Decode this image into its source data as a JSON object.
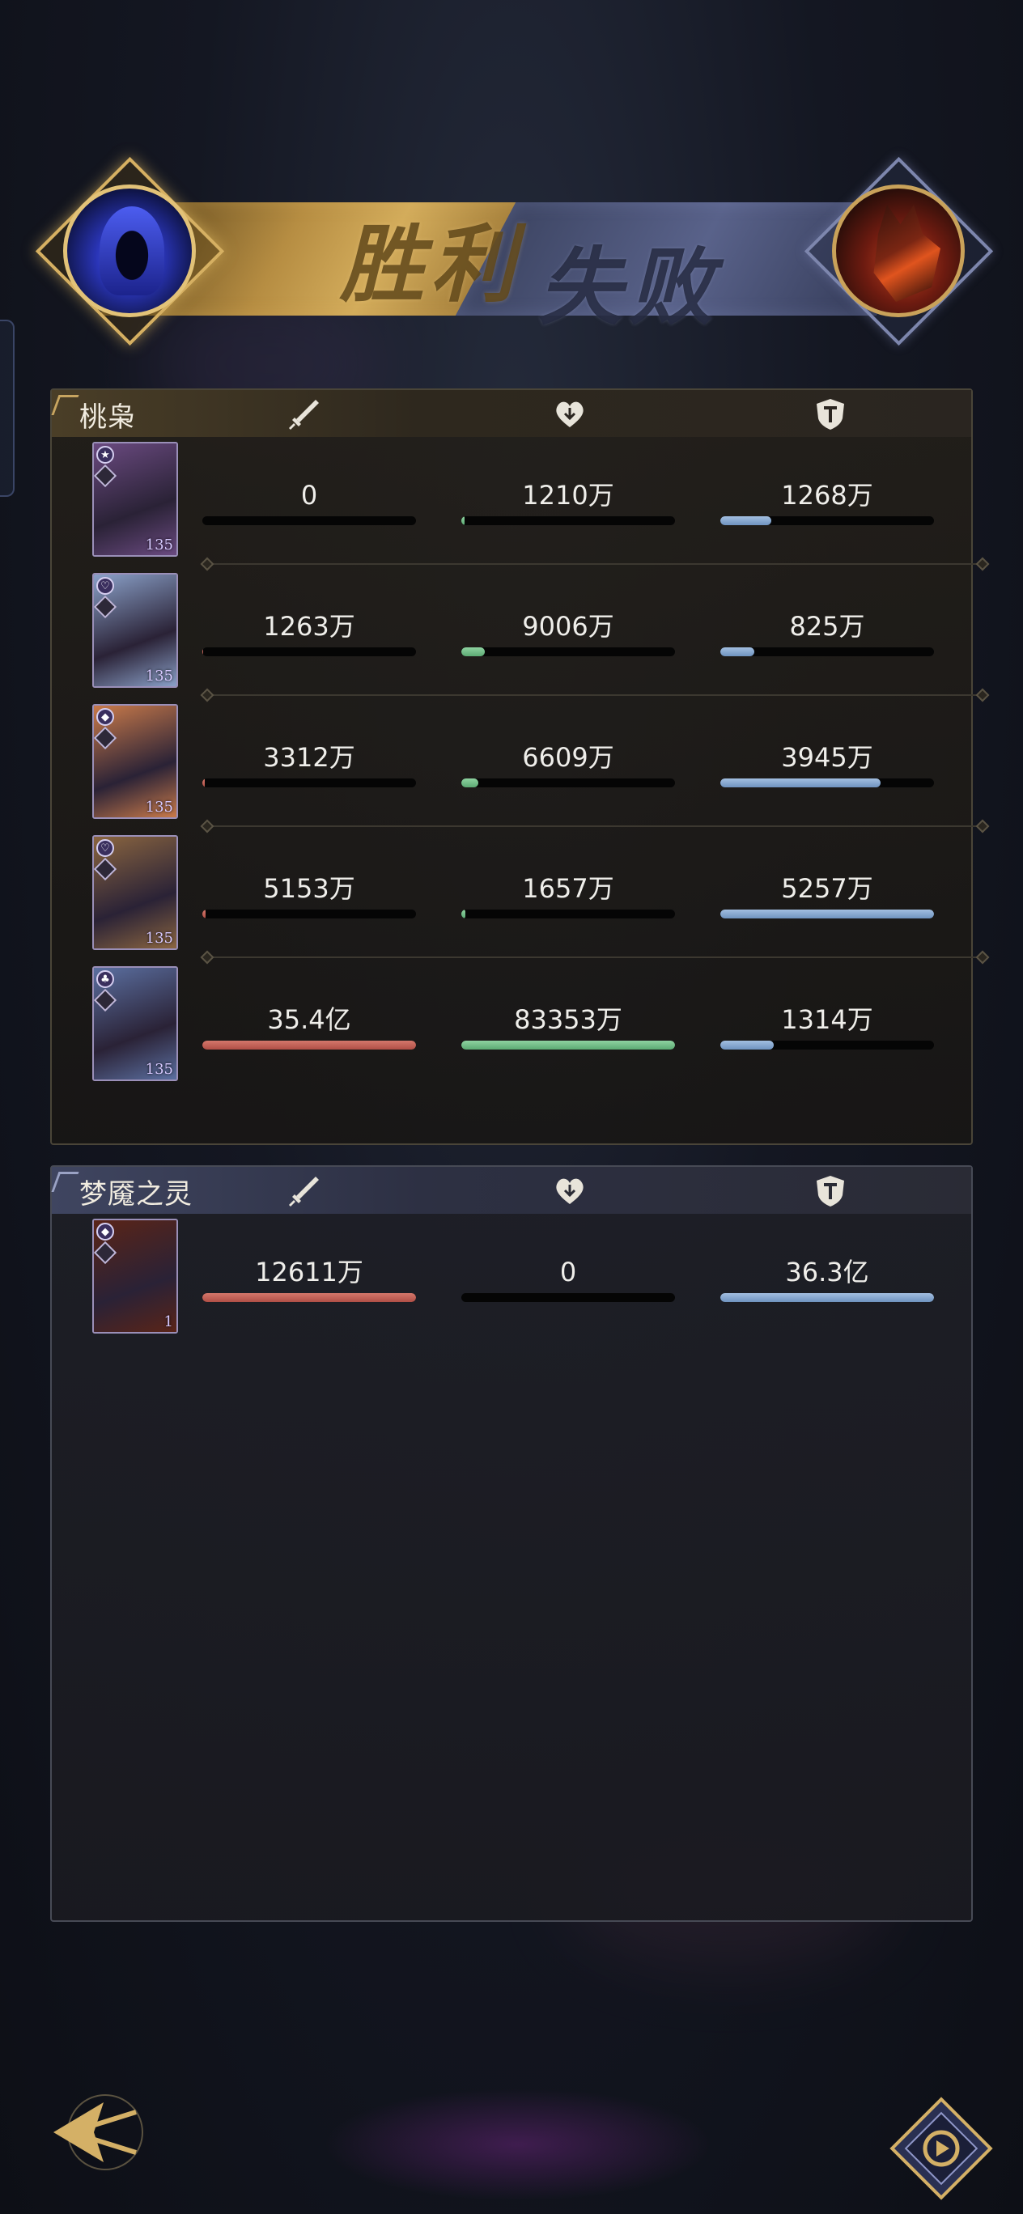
{
  "banner": {
    "win_text": "胜利",
    "lose_text": "失败"
  },
  "ally": {
    "team_name": "桃枭",
    "members": [
      {
        "level": "135",
        "damage": "0",
        "damage_pct": 0.0,
        "heal": "1210万",
        "heal_pct": 0.015,
        "tank": "1268万",
        "tank_pct": 0.24,
        "card_bg": "#6a4a80",
        "badge": "★"
      },
      {
        "level": "135",
        "damage": "1263万",
        "damage_pct": 0.005,
        "heal": "9006万",
        "heal_pct": 0.11,
        "tank": "825万",
        "tank_pct": 0.16,
        "card_bg": "#8aa0c8",
        "badge": "♡"
      },
      {
        "level": "135",
        "damage": "3312万",
        "damage_pct": 0.01,
        "heal": "6609万",
        "heal_pct": 0.08,
        "tank": "3945万",
        "tank_pct": 0.75,
        "card_bg": "#c97a4a",
        "badge": "◆"
      },
      {
        "level": "135",
        "damage": "5153万",
        "damage_pct": 0.015,
        "heal": "1657万",
        "heal_pct": 0.02,
        "tank": "5257万",
        "tank_pct": 1.0,
        "card_bg": "#8a6540",
        "badge": "♡"
      },
      {
        "level": "135",
        "damage": "35.4亿",
        "damage_pct": 1.0,
        "heal": "83353万",
        "heal_pct": 1.0,
        "tank": "1314万",
        "tank_pct": 0.25,
        "card_bg": "#5b6fa0",
        "badge": "♣"
      }
    ]
  },
  "enemy": {
    "team_name": "梦魇之灵",
    "members": [
      {
        "level": "1",
        "damage": "12611万",
        "damage_pct": 1.0,
        "heal": "0",
        "heal_pct": 0.0,
        "tank": "36.3亿",
        "tank_pct": 1.0,
        "card_bg": "#5a2418",
        "badge": "◆"
      }
    ]
  },
  "icons": {
    "damage": "sword-icon",
    "heal": "heart-icon",
    "tank": "shield-icon",
    "back": "back-arrow-icon",
    "replay": "replay-icon"
  },
  "colors": {
    "damage_bar": "#c05e54",
    "heal_bar": "#6fbd86",
    "tank_bar": "#85a6cf",
    "win_gold": "#c9a04f",
    "lose_slate": "#4b5478"
  }
}
